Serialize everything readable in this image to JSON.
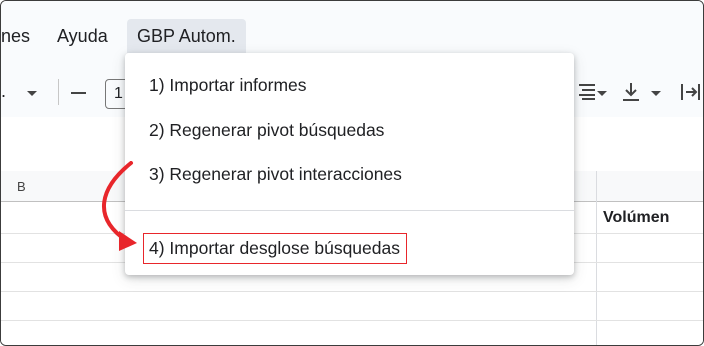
{
  "menubar": {
    "items": [
      "nes",
      "Ayuda",
      "GBP Autom."
    ]
  },
  "toolbar": {
    "font_partial": ".",
    "font_size_partial": "1"
  },
  "sheet": {
    "column_b": "B",
    "volume_header": "Volúmen"
  },
  "dropdown": {
    "items": [
      "1) Importar informes",
      "2) Regenerar pivot búsquedas",
      "3) Regenerar pivot interacciones",
      "4) Importar desglose búsquedas"
    ],
    "highlight_color": "#e8262b"
  },
  "annotation": {
    "arrow_color": "#e8262b"
  }
}
